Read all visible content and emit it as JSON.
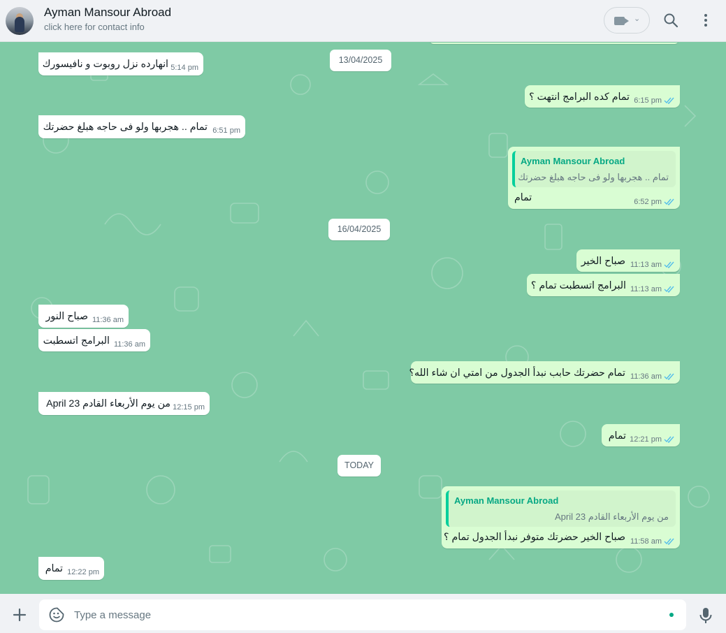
{
  "header": {
    "contact_name": "Ayman Mansour Abroad",
    "contact_sub": "click here for contact info"
  },
  "dates": [
    "13/04/2025",
    "16/04/2025",
    "TODAY"
  ],
  "messages": [
    {
      "dir": "in",
      "text": "انهارده نزل روبوت و نافيسورك",
      "time": "5:14 pm"
    },
    {
      "dir": "out",
      "text": "تمام كده البرامج انتهت ؟",
      "time": "6:15 pm"
    },
    {
      "dir": "in",
      "text": "تمام .. هجربها ولو فى حاجه هبلغ حضرتك",
      "time": "6:51 pm"
    },
    {
      "dir": "out",
      "quote_name": "Ayman Mansour Abroad",
      "quote_text": "تمام .. هجربها ولو فى حاجه هبلغ حضرتك",
      "text": "تمام",
      "time": "6:52 pm"
    },
    {
      "dir": "out",
      "text": "صباح الخير",
      "time": "11:13 am"
    },
    {
      "dir": "out",
      "text": "البرامج اتسطبت تمام ؟",
      "time": "11:13 am"
    },
    {
      "dir": "in",
      "text": "صباح النور",
      "time": "11:36 am"
    },
    {
      "dir": "in",
      "text": "البرامج اتسطبت",
      "time": "11:36 am"
    },
    {
      "dir": "out",
      "text": "تمام حضرتك حابب نبدأ الجدول من امتي ان شاء الله؟",
      "time": "11:36 am"
    },
    {
      "dir": "in",
      "text": "من يوم الأربعاء القادم April 23",
      "time": "12:15 pm"
    },
    {
      "dir": "out",
      "text": "تمام",
      "time": "12:21 pm"
    },
    {
      "dir": "out",
      "quote_name": "Ayman Mansour Abroad",
      "quote_text": "من يوم الأربعاء القادم April 23",
      "text": "صباح الخير حضرتك متوفر نبدأ الجدول تمام ؟",
      "time": "11:58 am"
    },
    {
      "dir": "in",
      "text": "تمام",
      "time": "12:22 pm"
    }
  ],
  "composer": {
    "placeholder": "Type a message"
  },
  "colors": {
    "chat_bg": "#7fcaa5",
    "outgoing": "#d9fdd3",
    "incoming": "#ffffff",
    "tick_read": "#53bdeb",
    "accent": "#06cf9c"
  },
  "icons": [
    "video-call-icon",
    "search-icon",
    "menu-icon",
    "plus-icon",
    "sticker-icon",
    "mic-icon",
    "double-tick-icon"
  ]
}
